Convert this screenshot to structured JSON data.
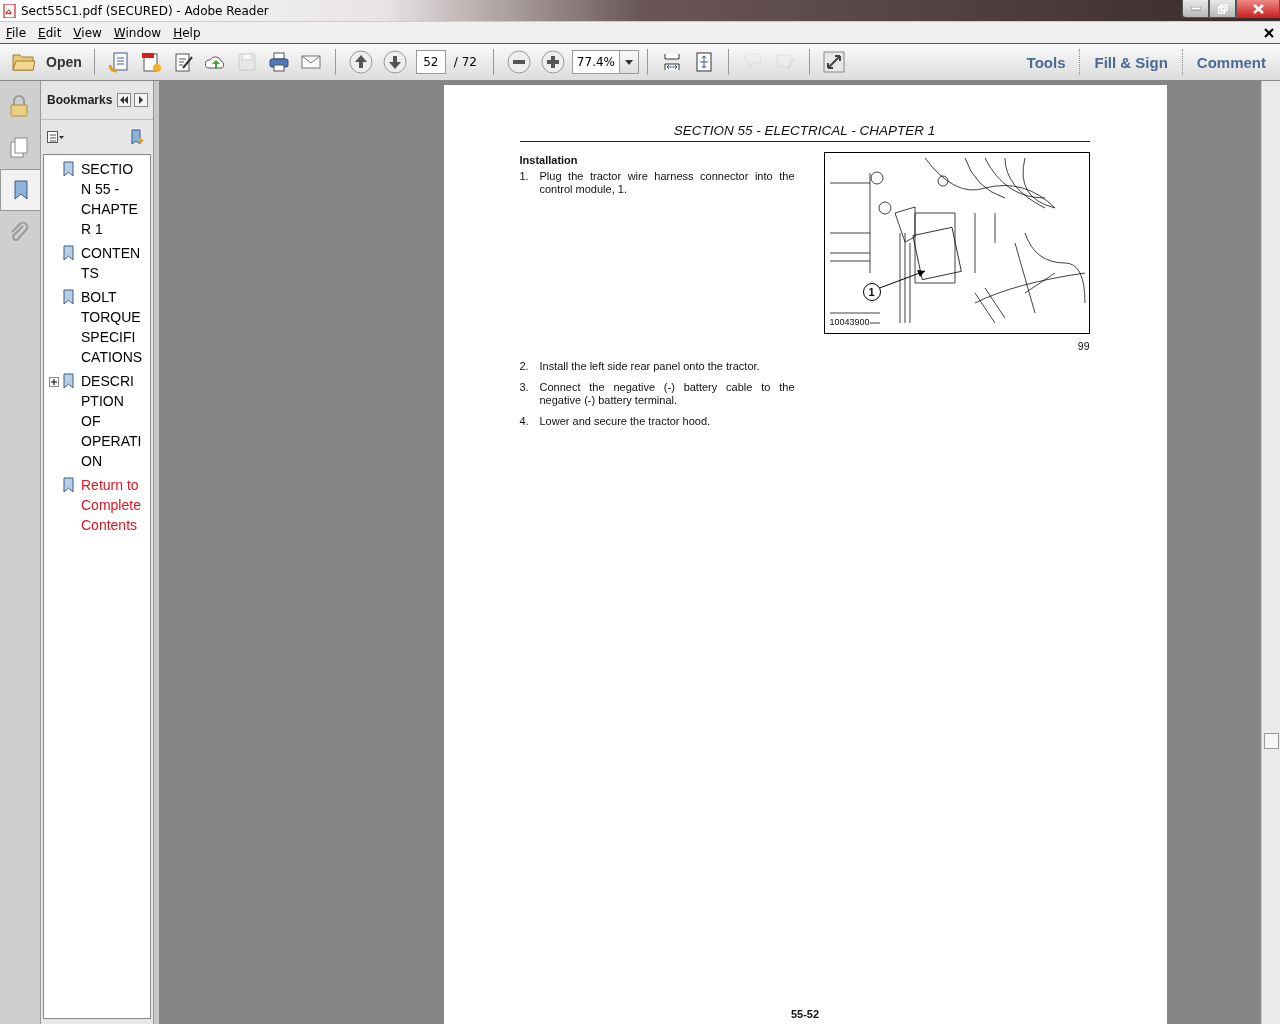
{
  "window": {
    "title": "Sect55C1.pdf (SECURED) - Adobe Reader"
  },
  "menu": [
    "File",
    "Edit",
    "View",
    "Window",
    "Help"
  ],
  "toolbar": {
    "open_label": "Open",
    "buttons": [
      {
        "kind": "create",
        "disabled": false
      },
      {
        "kind": "convert",
        "disabled": false
      },
      {
        "kind": "sign",
        "disabled": false
      },
      {
        "kind": "upload",
        "disabled": false
      },
      {
        "kind": "save",
        "disabled": true
      },
      {
        "kind": "print",
        "disabled": false
      },
      {
        "kind": "mail",
        "disabled": false
      }
    ],
    "page_number": "52",
    "page_total": "/ 72",
    "zoom": "77.4%",
    "view_buttons": [
      {
        "kind": "fitwidth",
        "disabled": false
      },
      {
        "kind": "fitpage",
        "disabled": false
      },
      {
        "kind": "comment",
        "disabled": true
      },
      {
        "kind": "textedit",
        "disabled": true
      },
      {
        "kind": "fullscreen",
        "disabled": false
      }
    ],
    "links": [
      "Tools",
      "Fill & Sign",
      "Comment"
    ]
  },
  "nav_tabs": [
    {
      "kind": "lock",
      "selected": false
    },
    {
      "kind": "pages",
      "selected": false
    },
    {
      "kind": "bookmarks",
      "selected": true
    },
    {
      "kind": "attachments",
      "selected": false
    }
  ],
  "bookmarks": {
    "title": "Bookmarks",
    "items": [
      {
        "label": "SECTION 55 - CHAPTER 1",
        "kind": "leaf",
        "color": "#000000"
      },
      {
        "label": "CONTENTS",
        "kind": "leaf",
        "color": "#000000"
      },
      {
        "label": "BOLT TORQUE SPECIFICATIONS",
        "kind": "leaf",
        "color": "#000000"
      },
      {
        "label": "DESCRIPTION OF OPERATION",
        "kind": "folder",
        "color": "#000000"
      },
      {
        "label": "Return to Complete Contents",
        "kind": "leaf",
        "color": "#e0141e"
      }
    ]
  },
  "page": {
    "header": "SECTION 55 - ELECTRICAL - CHAPTER 1",
    "heading": "Installation",
    "steps_before": [
      {
        "number": "1.",
        "text": "Plug the tractor wire harness connector into the control module, 1."
      }
    ],
    "figure": {
      "callout": "1",
      "code": "10043900",
      "number": "99"
    },
    "steps_after": [
      {
        "number": "2.",
        "text": "Install the left side rear panel onto the tractor."
      },
      {
        "number": "3.",
        "text": "Connect the negative (-) battery cable to the negative (-) battery terminal."
      },
      {
        "number": "4.",
        "text": "Lower and secure the tractor hood."
      }
    ],
    "footer": "55-52"
  }
}
